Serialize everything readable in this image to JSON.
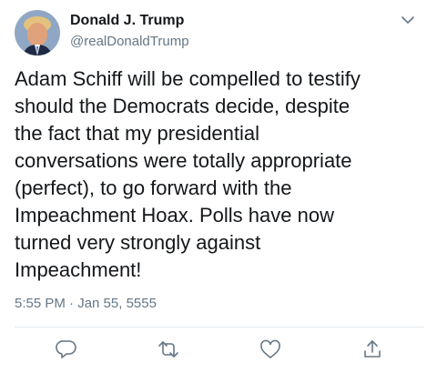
{
  "tweet": {
    "author": {
      "name": "Donald J. Trump",
      "handle": "@realDonaldTrump"
    },
    "text_lines": [
      "Adam Schiff will be compelled to testify",
      "should the Democrats decide, despite",
      "the fact that my presidential",
      "conversations were totally appropriate",
      "(perfect), to go forward with the",
      "Impeachment Hoax. Polls have now",
      "turned very strongly against",
      "Impeachment!"
    ],
    "timestamp": "5:55 PM · Jan 55, 5555"
  },
  "actions": [
    {
      "icon": "reply-icon"
    },
    {
      "icon": "retweet-icon"
    },
    {
      "icon": "like-icon"
    },
    {
      "icon": "share-icon"
    }
  ],
  "colors": {
    "text": "#14171a",
    "secondary": "#657786",
    "divider": "#e1e8ed",
    "icon": "#657786"
  }
}
